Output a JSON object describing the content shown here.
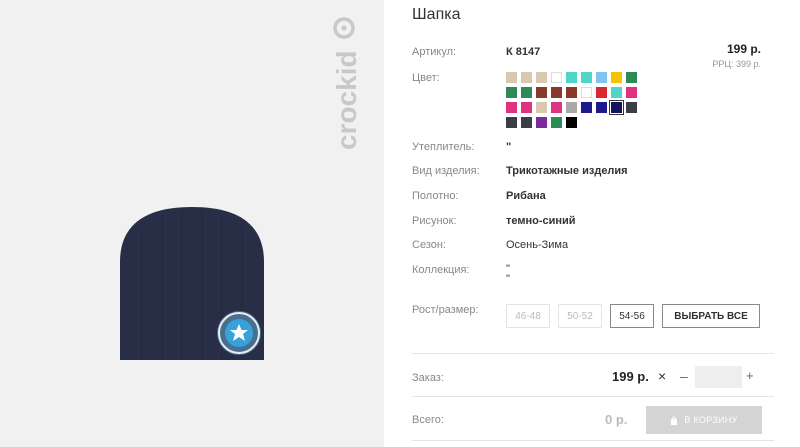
{
  "brand": {
    "logo_text": "crockid"
  },
  "product": {
    "title": "Шапка",
    "price": "199 р.",
    "rrp": "РРЦ: 399 р."
  },
  "labels": {
    "article": "Артикул:",
    "color": "Цвет:",
    "insulation": "Утеплитель:",
    "type": "Вид изделия:",
    "fabric": "Полотно:",
    "pattern": "Рисунок:",
    "season": "Сезон:",
    "collection": "Коллекция:",
    "size": "Рост/размер:",
    "order": "Заказ:",
    "total": "Всего:"
  },
  "values": {
    "article": "К 8147",
    "insulation": "\"",
    "type": "Трикотажные изделия",
    "fabric": "Рибана",
    "pattern": "темно-синий",
    "season": "Осень-Зима",
    "collection_line1": "\"",
    "collection_line2": "\""
  },
  "swatches": [
    "#d8c8b0",
    "#d8c8b0",
    "#d8c8b0",
    "#ffffff",
    "#4fd6c9",
    "#4fd6c9",
    "#82c3f0",
    "#f5c400",
    "#2e8b57",
    "#2e8b57",
    "#2e8b57",
    "#8b3a2a",
    "#8b3a2a",
    "#8b3a2a",
    "#ffffff",
    "#d9282f",
    "#4fd6c9",
    "#e0337f",
    "#e0337f",
    "#e0337f",
    "#d8c8b0",
    "#e0337f",
    "#a8a8a8",
    "#1c1a8c",
    "#1c1a8c",
    "#13135e",
    "#3d3d46",
    "#3d3d46",
    "#3d3d46",
    "#7d2a9c",
    "#2e8b57",
    "#000000"
  ],
  "selected_swatch_index": 25,
  "sizes": [
    {
      "label": "46-48",
      "active": false
    },
    {
      "label": "50-52",
      "active": false
    },
    {
      "label": "54-56",
      "active": true
    }
  ],
  "buttons": {
    "select_all": "ВЫБРАТЬ ВСЕ",
    "cart": "В КОРЗИНУ"
  },
  "order": {
    "unit_price": "199 р.",
    "times_symbol": "×",
    "minus": "–",
    "plus": "+",
    "quantity": ""
  },
  "total": {
    "amount": "0 р."
  },
  "colors": {
    "hat": "#272e45",
    "badge_outer": "#4a6f8e",
    "badge_inner": "#35a3d9",
    "cart_button": "#d4d4d4",
    "photo_bg": "#f1f1f1"
  }
}
